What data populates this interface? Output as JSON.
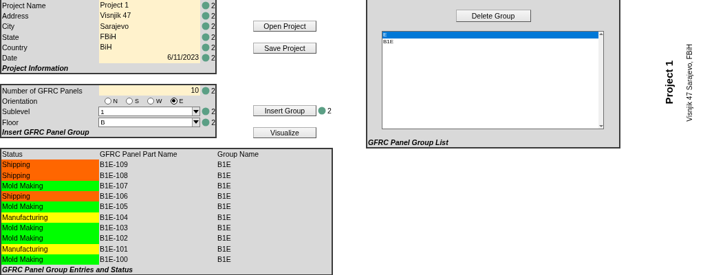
{
  "project_information": {
    "title": "Project Information",
    "fields": [
      {
        "label": "Project Name",
        "kind": "text",
        "value": "Project 1",
        "badge": "2"
      },
      {
        "label": "Address",
        "kind": "text",
        "value": "Visnjik 47",
        "badge": "2"
      },
      {
        "label": "City",
        "kind": "text",
        "value": "Sarajevo",
        "badge": "2"
      },
      {
        "label": "State",
        "kind": "text",
        "value": "FBiH",
        "badge": "2"
      },
      {
        "label": "Country",
        "kind": "text",
        "value": "BiH",
        "badge": "2"
      },
      {
        "label": "Date",
        "kind": "date",
        "value": "6/11/2023",
        "badge": "2"
      }
    ]
  },
  "project_actions": [
    {
      "label": "Open Project"
    },
    {
      "label": "Save Project"
    }
  ],
  "insert_group": {
    "title": "Insert GFRC Panel Group",
    "fields": [
      {
        "label": "Number of GFRC Panels",
        "kind": "number",
        "value": "10",
        "badge": "2"
      },
      {
        "label": "Orientation",
        "kind": "radio",
        "options": [
          {
            "label": "N",
            "selected": false
          },
          {
            "label": "S",
            "selected": false
          },
          {
            "label": "W",
            "selected": false
          },
          {
            "label": "E",
            "selected": true
          }
        ]
      },
      {
        "label": "Sublevel",
        "kind": "dropdown",
        "value": "1",
        "badge": "2"
      },
      {
        "label": "Floor",
        "kind": "dropdown",
        "value": "B",
        "badge": "2"
      }
    ]
  },
  "group_actions": [
    {
      "label": "Insert Group",
      "badge": "2"
    },
    {
      "label": "Visualize"
    }
  ],
  "group_list": {
    "title": "GFRC Panel Group List",
    "delete_button": "Delete Group",
    "items": [
      {
        "label": "E",
        "selected": true
      },
      {
        "label": "B1E",
        "selected": false
      }
    ]
  },
  "entries": {
    "title": "GFRC Panel Group Entries and Status",
    "columns": [
      "Status",
      "GFRC Panel Part Name",
      "Group Name"
    ],
    "rows": [
      {
        "status": "Shipping",
        "color": "#ff6600",
        "part": "B1E-109",
        "group": "B1E"
      },
      {
        "status": "Shipping",
        "color": "#ff6600",
        "part": "B1E-108",
        "group": "B1E"
      },
      {
        "status": "Mold Making",
        "color": "#00ff00",
        "part": "B1E-107",
        "group": "B1E"
      },
      {
        "status": "Shipping",
        "color": "#ff6600",
        "part": "B1E-106",
        "group": "B1E"
      },
      {
        "status": "Mold Making",
        "color": "#00ff00",
        "part": "B1E-105",
        "group": "B1E"
      },
      {
        "status": "Manufacturing",
        "color": "#ffff00",
        "part": "B1E-104",
        "group": "B1E"
      },
      {
        "status": "Mold Making",
        "color": "#00ff00",
        "part": "B1E-103",
        "group": "B1E"
      },
      {
        "status": "Mold Making",
        "color": "#00ff00",
        "part": "B1E-102",
        "group": "B1E"
      },
      {
        "status": "Manufacturing",
        "color": "#ffff00",
        "part": "B1E-101",
        "group": "B1E"
      },
      {
        "status": "Mold Making",
        "color": "#00ff00",
        "part": "B1E-100",
        "group": "B1E"
      }
    ]
  },
  "side_title": {
    "title": "Project 1",
    "subtitle": "Visnjik 47 Sarajevo, FBiH"
  }
}
